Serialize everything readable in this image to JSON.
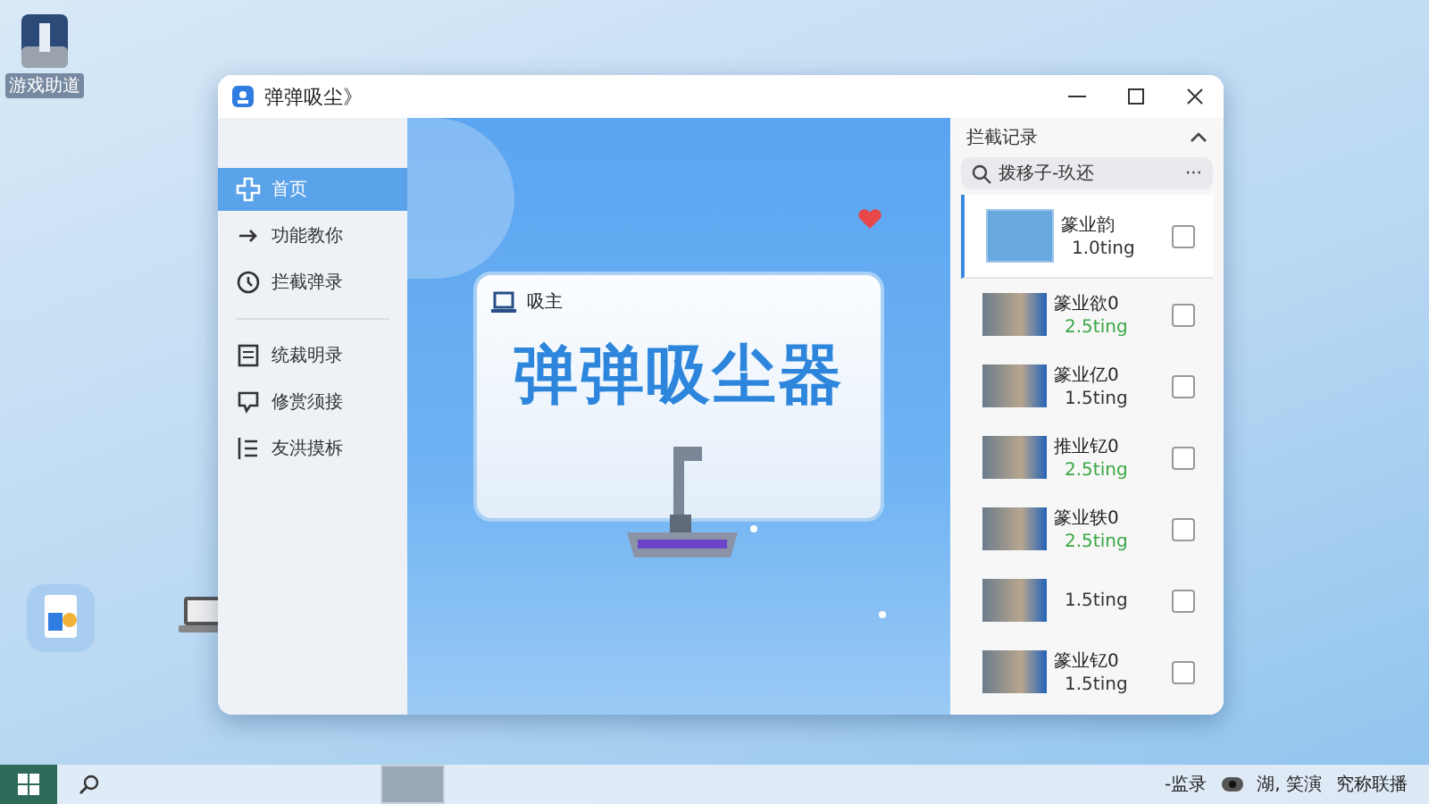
{
  "desktop": {
    "icons": [
      {
        "label": "游戏助道"
      }
    ]
  },
  "window": {
    "title": "弹弹吸尘》"
  },
  "sidebar": {
    "items": [
      {
        "label": "首页",
        "kind": "home",
        "selected": true
      },
      {
        "label": "功能教你",
        "kind": "arrow",
        "selected": false
      },
      {
        "label": "拦截弹录",
        "kind": "clock",
        "selected": false,
        "divider_after": true
      },
      {
        "label": "统裁明录",
        "kind": "doc",
        "selected": false
      },
      {
        "label": "修赏须接",
        "kind": "chat",
        "selected": false
      },
      {
        "label": "友洪摸柝",
        "kind": "list",
        "selected": false
      }
    ]
  },
  "banner": {
    "card_label": "吸主",
    "headline": "弹弹吸尘器"
  },
  "records": {
    "title": "拦截记录",
    "expanded": true,
    "search": {
      "placeholder": "拨移子-玖还"
    },
    "more": "···",
    "items": [
      {
        "name": "篆业韵",
        "size": "1.0ting",
        "color": "#333333",
        "selected": true,
        "checked": false
      },
      {
        "name": "篆业欲0",
        "size": "2.5ting",
        "color": "#3aa845",
        "selected": false,
        "checked": false
      },
      {
        "name": "篆业亿0",
        "size": "1.5ting",
        "color": "#333333",
        "selected": false,
        "checked": false
      },
      {
        "name": "推业钇0",
        "size": "2.5ting",
        "color": "#3aa845",
        "selected": false,
        "checked": false
      },
      {
        "name": "篆业轶0",
        "size": "2.5ting",
        "color": "#3aa845",
        "selected": false,
        "checked": false
      },
      {
        "size": "1.5ting",
        "color": "#333333",
        "selected": false,
        "checked": false
      },
      {
        "name": "篆业钇0",
        "size": "1.5ting",
        "color": "#333333",
        "selected": false,
        "checked": false
      }
    ]
  },
  "taskbar": {
    "tray": [
      {
        "label": "-监录",
        "kind": "text"
      },
      {
        "label": "湖, 笑演",
        "kind": "dot"
      },
      {
        "label": "究称联播",
        "kind": "text"
      }
    ]
  }
}
